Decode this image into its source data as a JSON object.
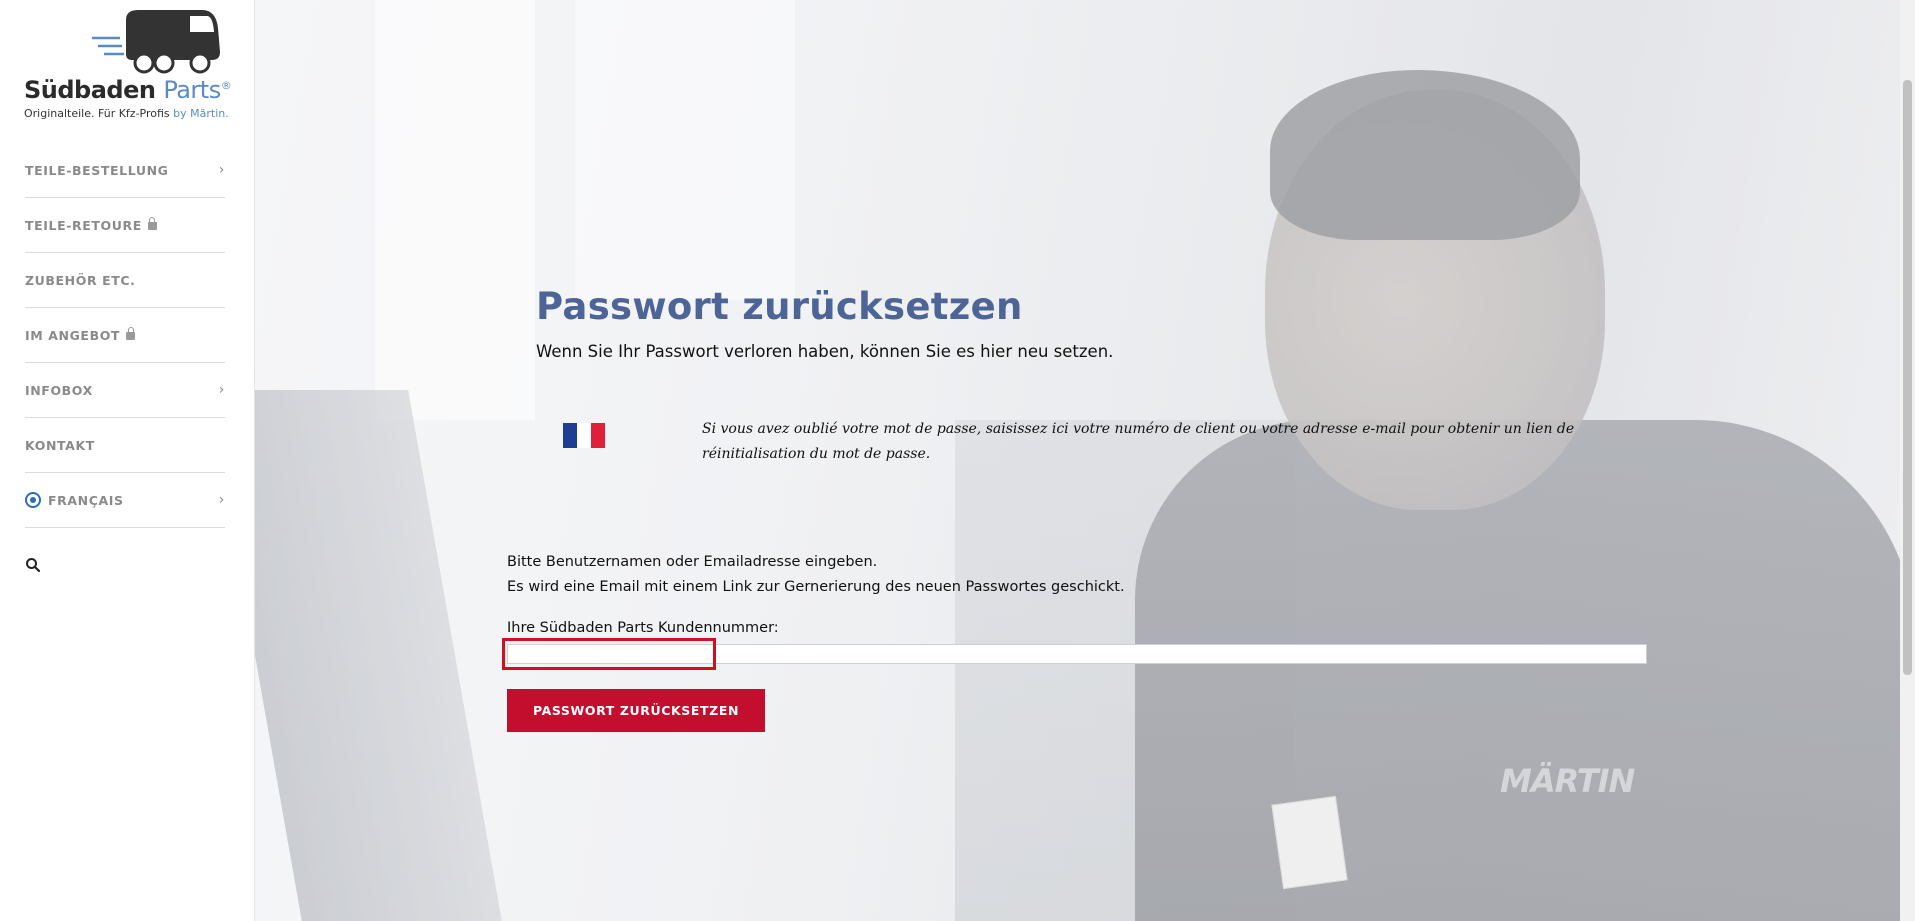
{
  "brand": {
    "name_primary": "Südbaden",
    "name_accent": "Parts",
    "registered": "®",
    "tagline": "Originalteile. Für Kfz-Profis",
    "tagline_by": "by Märtin."
  },
  "nav": {
    "items": [
      {
        "label": "TEILE-BESTELLUNG",
        "chevron": "›"
      },
      {
        "label": "TEILE-RETOURE",
        "icon": "lock-icon"
      },
      {
        "label": "ZUBEHÖR ETC."
      },
      {
        "label": "IM ANGEBOT",
        "icon": "lock-icon"
      },
      {
        "label": "INFOBOX",
        "chevron": "›"
      },
      {
        "label": "KONTAKT"
      },
      {
        "label": "FRANÇAIS",
        "icon": "globe-icon",
        "chevron": "›"
      }
    ]
  },
  "page": {
    "title": "Passwort zurücksetzen",
    "subtitle": "Wenn Sie Ihr Passwort verloren haben, können Sie es hier neu setzen.",
    "french_text": "Si vous avez oublié votre mot de passe, saisissez ici votre numéro de client ou votre adresse e-mail pour obtenir un lien de réinitialisation du mot de passe.",
    "instruction_line1": "Bitte Benutzernamen oder Emailadresse eingeben.",
    "instruction_line2": "Es wird eine Email mit einem Link zur Gernerierung des neuen Passwortes geschickt.",
    "field_label": "Ihre Südbaden Parts Kundennummer:",
    "field_value": "",
    "reset_button": "PASSWORT ZURÜCKSETZEN",
    "background_text": "MÄRTIN"
  },
  "colors": {
    "title": "#4d6596",
    "button": "#c30e2e",
    "accent_blue": "#5a8ac6",
    "highlight": "#d1101f",
    "flag": [
      "#1f3e93",
      "#ffffff",
      "#e0203a"
    ]
  }
}
